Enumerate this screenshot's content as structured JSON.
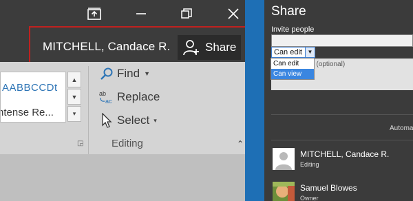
{
  "word": {
    "user_name": "MITCHELL, Candace R.",
    "share_label": "Share",
    "styles": {
      "preview_heading": "AABBCCDt",
      "preview_intense": "ntense Re..."
    },
    "editing": {
      "find_label": "Find",
      "replace_label": "Replace",
      "select_label": "Select",
      "group_label": "Editing"
    },
    "colors": {
      "highlight_border": "#c0211f"
    }
  },
  "share_pane": {
    "title": "Share",
    "invite_label": "Invite people",
    "permission": {
      "selected": "Can edit",
      "options": [
        {
          "label": "Can edit",
          "selected": false
        },
        {
          "label": "Can view",
          "selected": true
        }
      ]
    },
    "message_placeholder": "age (optional)",
    "auto_text": "Automa",
    "people": [
      {
        "name": "MITCHELL, Candace R.",
        "role": "Editing",
        "avatar": "default-user-icon"
      },
      {
        "name": "Samuel Blowes",
        "role": "Owner",
        "avatar": "photo-avatar"
      }
    ],
    "colors": {
      "accent": "#1e6fb5",
      "pane_bg": "#3b3b3b",
      "selected_option": "#3a86e0"
    }
  }
}
